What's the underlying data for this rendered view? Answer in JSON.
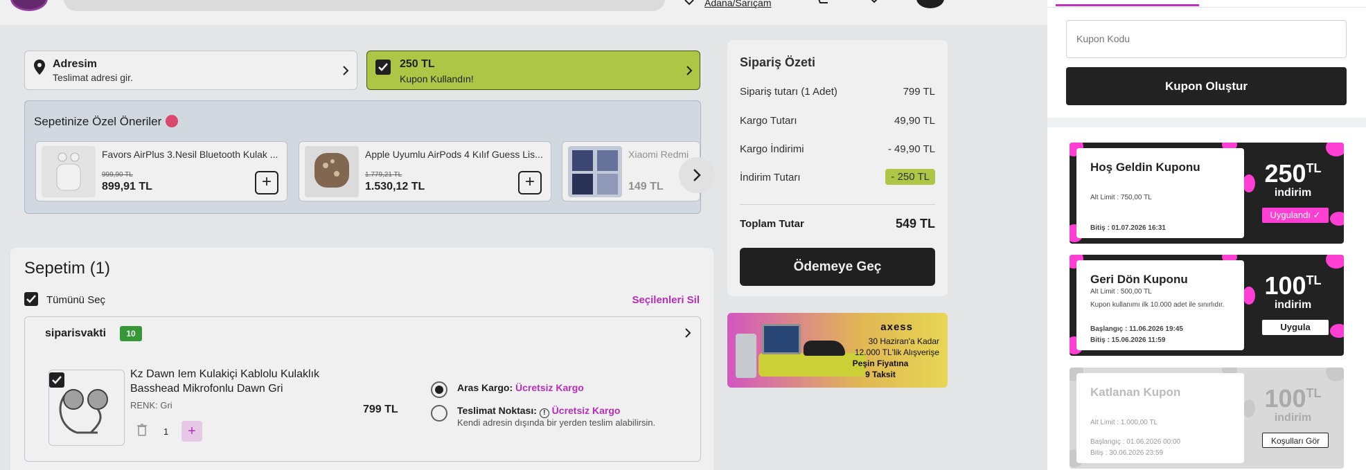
{
  "header": {
    "location_label": "Adana/Sarıçam"
  },
  "address": {
    "title": "Adresim",
    "subtitle": "Teslimat adresi gir."
  },
  "coupon_status": {
    "amount": "250 TL",
    "message": "Kupon Kullandın!"
  },
  "recommendations": {
    "title": "Sepetinize Özel Öneriler",
    "items": [
      {
        "name": "Favors AirPlus 3.Nesil Bluetooth Kulak ...",
        "old_price": "999,90 TL",
        "price": "899,91 TL"
      },
      {
        "name": "Apple Uyumlu AirPods 4 Kılıf Guess Lis...",
        "old_price": "1.779,21 TL",
        "price": "1.530,12 TL"
      },
      {
        "name": "Xiaomi Redmi",
        "old_price": "",
        "price": "149 TL"
      }
    ]
  },
  "cart": {
    "title": "Sepetim (1)",
    "select_all": "Tümünü Seç",
    "delete_selected": "Seçilenleri Sil",
    "seller": {
      "name": "siparisvakti",
      "rating": "10"
    },
    "item": {
      "name": "Kz Dawn Iem Kulakiçi Kablolu Kulaklık Basshead Mikrofonlu Dawn Gri",
      "variant": "RENK: Gri",
      "quantity": "1",
      "price": "799 TL"
    },
    "shipping": {
      "option1_label": "Aras Kargo:",
      "option1_value": "Ücretsiz Kargo",
      "option2_label": "Teslimat Noktası:",
      "option2_value": "Ücretsiz Kargo",
      "option2_note": "Kendi adresin dışında bir yerden teslim alabilirsin."
    }
  },
  "summary": {
    "title": "Sipariş Özeti",
    "rows": [
      {
        "label": "Sipariş tutarı (1 Adet)",
        "value": "799 TL"
      },
      {
        "label": "Kargo Tutarı",
        "value": "49,90 TL"
      },
      {
        "label": "Kargo İndirimi",
        "value": "- 49,90 TL"
      },
      {
        "label": "İndirim Tutarı",
        "value": "- 250 TL"
      }
    ],
    "total_label": "Toplam Tutar",
    "total_value": "549 TL",
    "pay_button": "Ödemeye Geç"
  },
  "banner": {
    "brand": "axess",
    "line1": "30 Haziran'a Kadar",
    "line2": "12.000 TL'lik Alışverişe",
    "line3": "Peşin Fiyatına",
    "line4": "9 Taksit"
  },
  "side_panel": {
    "coupon_input_placeholder": "Kupon Kodu",
    "create_button": "Kupon Oluştur",
    "coupons": [
      {
        "name": "Hoş Geldin Kuponu",
        "limit": "Alt Limit : 750,00 TL",
        "end": "Bitiş : 01.07.2026 16:31",
        "amount": "250",
        "unit": "TL",
        "discount_label": "indirim",
        "action": "Uygulandı ✓",
        "color": "#222222"
      },
      {
        "name": "Geri Dön Kuponu",
        "limit": "Alt Limit : 500,00 TL",
        "note": "Kupon kullanımı ilk 10.000 adet ile sınırlıdır.",
        "start": "Başlangıç : 11.06.2026 19:45",
        "end": "Bitiş : 15.06.2026 11:59",
        "amount": "100",
        "unit": "TL",
        "discount_label": "indirim",
        "action": "Uygula",
        "color": "#222222"
      },
      {
        "name": "Katlanan Kupon",
        "limit": "Alt Limit : 1.000,00 TL",
        "start": "Başlangıç : 01.06.2026 00:00",
        "end": "Bitiş : 30.06.2026 23:59",
        "amount": "100",
        "unit": "TL",
        "discount_label": "indirim",
        "action": "Koşulları Gör",
        "color": "#d9d9d9"
      }
    ]
  },
  "colors": {
    "accent": "#c230c4",
    "coupon_green": "#b9d34a",
    "dark": "#222222"
  }
}
